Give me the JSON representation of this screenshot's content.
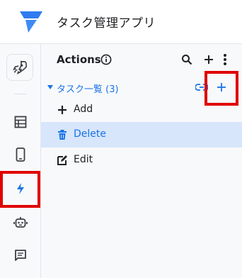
{
  "app": {
    "title": "タスク管理アプリ"
  },
  "panel": {
    "title": "Actions"
  },
  "group": {
    "label": "タスク一覧 (3)"
  },
  "actions": [
    {
      "label": "Add",
      "selected": false
    },
    {
      "label": "Delete",
      "selected": true
    },
    {
      "label": "Edit",
      "selected": false
    }
  ],
  "colors": {
    "accent": "#1a73e8",
    "highlight": "#e00000",
    "selected_bg": "#d7e6fb"
  },
  "icons": {
    "rail": [
      "rocket-icon",
      "table-icon",
      "phone-icon",
      "lightning-icon",
      "robot-icon",
      "chat-icon"
    ],
    "header": [
      "info-icon",
      "search-icon",
      "add-icon",
      "more-vert-icon"
    ],
    "group": [
      "caret-down-icon",
      "link-icon",
      "add-icon"
    ],
    "actions": [
      "add-icon",
      "trash-icon",
      "edit-icon"
    ]
  }
}
